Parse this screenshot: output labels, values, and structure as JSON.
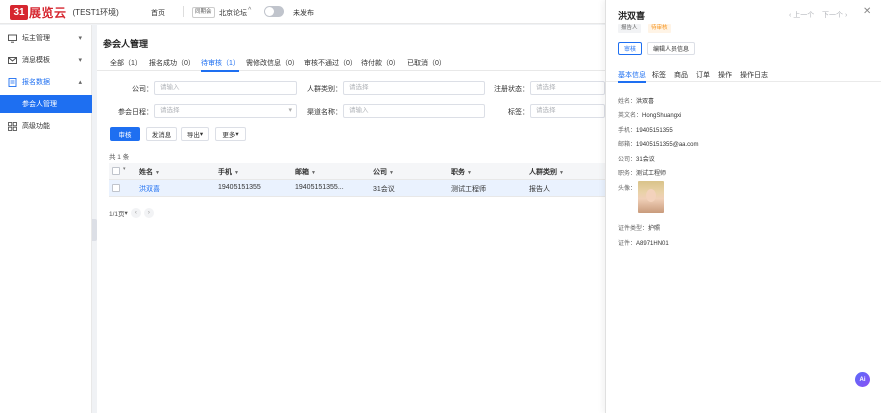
{
  "header": {
    "logo_mark": "31",
    "logo_text": "展览云",
    "env": "(TEST1环境)",
    "home": "首页",
    "forum_tag": "同期会",
    "forum_name": "北京论坛",
    "toggle_label": "未发布"
  },
  "sidebar": {
    "items": [
      {
        "label": "坛主管理",
        "icon": "monitor-icon",
        "arrow": "▾"
      },
      {
        "label": "消息模板",
        "icon": "message-icon",
        "arrow": "▾"
      },
      {
        "label": "报名数据",
        "icon": "form-icon",
        "arrow": "▴"
      },
      {
        "label": "高级功能",
        "icon": "grid-icon",
        "arrow": ""
      }
    ],
    "active_sub": "参会人管理"
  },
  "main": {
    "title": "参会人管理",
    "tabs": [
      {
        "label": "全部（1）"
      },
      {
        "label": "报名成功（0）"
      },
      {
        "label": "待审核（1）"
      },
      {
        "label": "需修改信息（0）"
      },
      {
        "label": "审核不通过（0）"
      },
      {
        "label": "待付款（0）"
      },
      {
        "label": "已取消（0）"
      }
    ],
    "filters": {
      "company_label": "公司：",
      "company_placeholder": "请输入",
      "crowd_label": "人群类别：",
      "crowd_placeholder": "请选择",
      "reg_label": "注册状态：",
      "reg_placeholder": "请选择",
      "schedule_label": "参会日程：",
      "schedule_placeholder": "请选择",
      "channel_label": "渠道名称：",
      "channel_placeholder": "请输入",
      "tag_label": "标签：",
      "tag_placeholder": "请选择"
    },
    "actions": {
      "review": "审核",
      "send": "发消息",
      "export": "导出",
      "more": "更多"
    },
    "total": "共 1 条",
    "columns": [
      "姓名",
      "手机",
      "邮箱",
      "公司",
      "职务",
      "人群类别"
    ],
    "rows": [
      {
        "name": "洪双喜",
        "phone": "19405151355",
        "email": "19405151355...",
        "company": "31会议",
        "title": "测试工程师",
        "crowd": "报告人"
      }
    ],
    "pager": {
      "per_page": "1/1页",
      "caret": "▾"
    }
  },
  "drawer": {
    "name": "洪双喜",
    "tag1": "报告人",
    "tag2": "待审核",
    "prev": "‹ 上一个",
    "next": "下一个 ›",
    "btn_review": "审核",
    "btn_edit": "编辑人员信息",
    "tabs": [
      "基本信息",
      "标签",
      "商品",
      "订单",
      "操作",
      "操作日志"
    ],
    "fields": {
      "name_k": "姓名：",
      "name_v": "洪双喜",
      "en_k": "英文名：",
      "en_v": "HongShuangxi",
      "phone_k": "手机：",
      "phone_v": "19405151355",
      "email_k": "邮箱：",
      "email_v": "19405151355@aa.com",
      "company_k": "公司：",
      "company_v": "31会议",
      "title_k": "职务：",
      "title_v": "测试工程师",
      "avatar_k": "头像：",
      "idtype_k": "证件类型：",
      "idtype_v": "护照",
      "id_k": "证件：",
      "id_v": "A8971HN01"
    },
    "ai": "Ai"
  },
  "colors": {
    "accent": "#1e6ff1",
    "brand": "#d6262f",
    "pending": "#f7941d"
  }
}
